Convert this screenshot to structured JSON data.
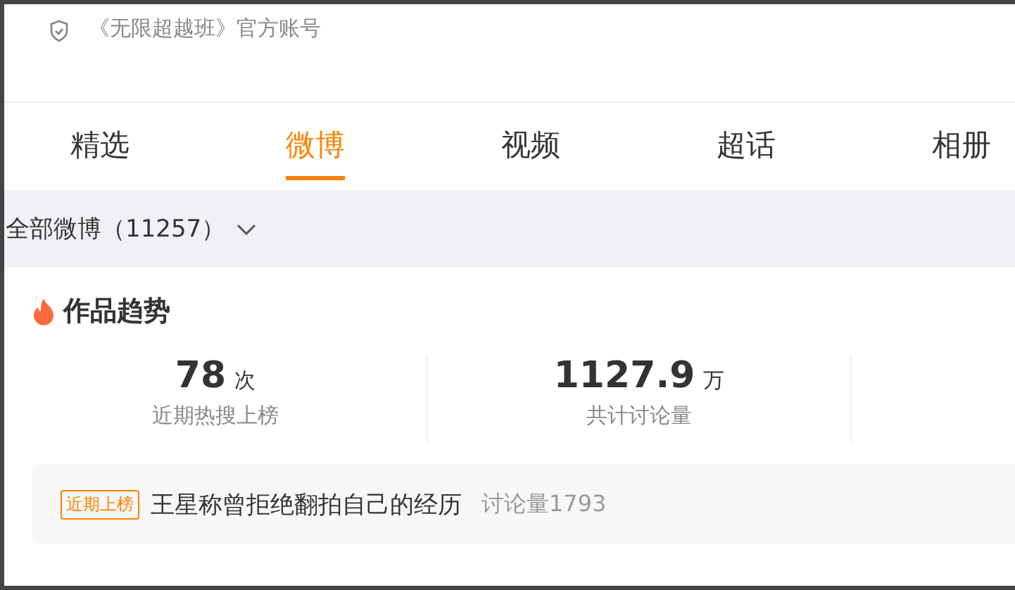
{
  "account": {
    "label": "《无限超越班》官方账号"
  },
  "tabs": [
    {
      "label": "精选",
      "selected": false
    },
    {
      "label": "微博",
      "selected": true
    },
    {
      "label": "视频",
      "selected": false
    },
    {
      "label": "超话",
      "selected": false
    },
    {
      "label": "相册",
      "selected": false
    }
  ],
  "filter": {
    "label": "全部微博（11257）"
  },
  "trend": {
    "title": "作品趋势",
    "stats": [
      {
        "value": "78",
        "unit": "次",
        "label": "近期热搜上榜"
      },
      {
        "value": "1127.9",
        "unit": "万",
        "label": "共计讨论量"
      }
    ],
    "item": {
      "badge": "近期上榜",
      "title": "王星称曾拒绝翻拍自己的经历",
      "count": "讨论量1793"
    }
  }
}
